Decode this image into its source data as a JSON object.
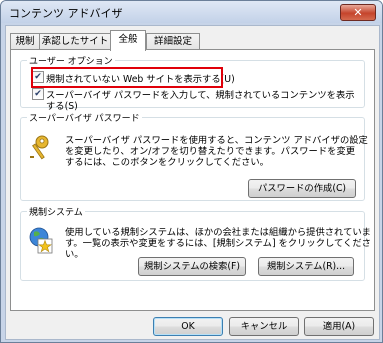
{
  "window": {
    "title": "コンテンツ アドバイザ",
    "close_label": "✕"
  },
  "tabs": [
    {
      "label": "規制"
    },
    {
      "label": "承認したサイト"
    },
    {
      "label": "全般"
    },
    {
      "label": "詳細設定"
    }
  ],
  "user_options": {
    "group_label": "ユーザー オプション",
    "option1": {
      "label": "規制されていない Web サイトを表示する(U)",
      "checked": true
    },
    "option2": {
      "label_line1": "スーパーバイザ パスワードを入力して、規制されているコンテンツを表示",
      "label_line2": "する(S)",
      "checked": true
    }
  },
  "supervisor": {
    "group_label": "スーパーバイザ パスワード",
    "desc_line1": "スーパーバイザ パスワードを使用すると、コンテンツ アドバイザの設定",
    "desc_line2": "を変更したり、オン/オフを切り替えたりできます。パスワードを変更",
    "desc_line3": "するには、このボタンをクリックしてください。",
    "create_password_button": "パスワードの作成(C)"
  },
  "rating_systems": {
    "group_label": "規制システム",
    "desc_line1": "使用している規制システムは、ほかの会社または組織から提供されていま",
    "desc_line2": "す。一覧の表示や変更をするには、[規制システム] をクリックしてくださ",
    "desc_line3": "い。",
    "find_button": "規制システムの検索(F)",
    "systems_button": "規制システム(R)..."
  },
  "footer": {
    "ok_label": "OK",
    "cancel_label": "キャンセル",
    "apply_label": "適用(A)"
  },
  "colors": {
    "highlight": "#e0000a"
  }
}
